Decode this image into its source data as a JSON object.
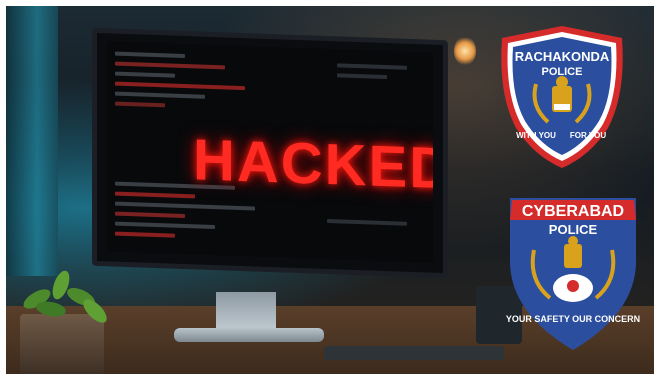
{
  "screen_text": "HACKED",
  "badges": {
    "rachakonda": {
      "name": "RACHAKONDA",
      "subtitle": "POLICE",
      "motto_left": "WITH YOU",
      "motto_right": "FOR YOU"
    },
    "cyberabad": {
      "name": "CYBERABAD",
      "subtitle": "POLICE",
      "motto": "YOUR SAFETY  OUR CONCERN"
    }
  },
  "colors": {
    "hacked_red": "#ff2a22",
    "badge_blue": "#2b4f9e",
    "badge_red": "#d62b2b",
    "badge_gold": "#d9a21c"
  }
}
